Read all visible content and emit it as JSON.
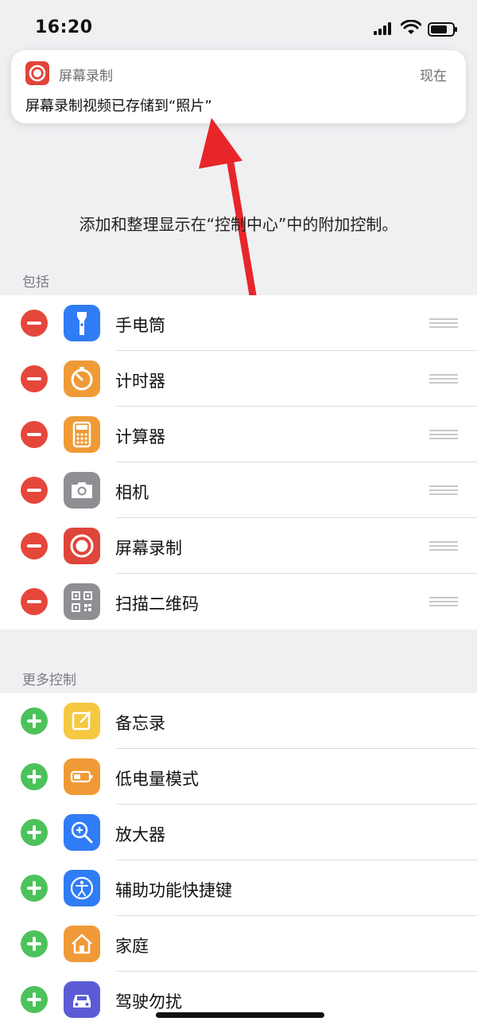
{
  "status_bar": {
    "time": "16:20",
    "icons": [
      "cellular-signal-icon",
      "wifi-icon",
      "battery-icon"
    ]
  },
  "notification": {
    "app_name": "屏幕录制",
    "time": "现在",
    "body": "屏幕录制视频已存储到“照片”",
    "icon": "screen-record-icon"
  },
  "description": "添加和整理显示在“控制中心”中的附加控制。",
  "included": {
    "header": "包括",
    "items": [
      {
        "label": "手电筒",
        "icon": "flashlight-icon",
        "color": "#2f7cf6"
      },
      {
        "label": "计时器",
        "icon": "timer-icon",
        "color": "#f09a37"
      },
      {
        "label": "计算器",
        "icon": "calculator-icon",
        "color": "#f09a37"
      },
      {
        "label": "相机",
        "icon": "camera-icon",
        "color": "#8e8e93"
      },
      {
        "label": "屏幕录制",
        "icon": "screen-record-icon",
        "color": "#e0453a"
      },
      {
        "label": "扫描二维码",
        "icon": "qr-code-icon",
        "color": "#8e8e93"
      }
    ]
  },
  "more": {
    "header": "更多控制",
    "items": [
      {
        "label": "备忘录",
        "icon": "notes-icon",
        "color": "#f5c842"
      },
      {
        "label": "低电量模式",
        "icon": "low-power-icon",
        "color": "#f09a37"
      },
      {
        "label": "放大器",
        "icon": "magnifier-icon",
        "color": "#2f7cf6"
      },
      {
        "label": "辅助功能快捷键",
        "icon": "accessibility-icon",
        "color": "#2f7cf6"
      },
      {
        "label": "家庭",
        "icon": "home-icon",
        "color": "#f09a37"
      },
      {
        "label": "驾驶勿扰",
        "icon": "car-icon",
        "color": "#5b5bd6"
      }
    ]
  },
  "colors": {
    "remove": "#e5473b",
    "add": "#4cc25a",
    "annotation_arrow": "#e8262a"
  }
}
